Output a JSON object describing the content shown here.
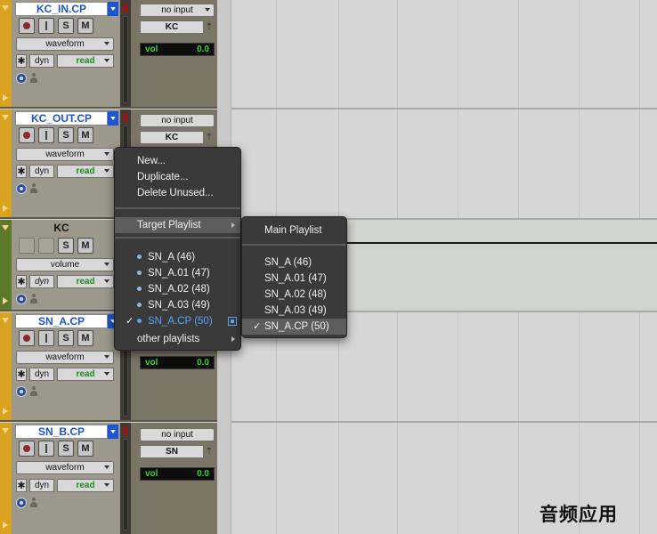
{
  "tracks": [
    {
      "name": "KC_IN.CP",
      "buttons": {
        "solo": "S",
        "mute": "M"
      },
      "view": "waveform",
      "dyn": "dyn",
      "automation": "read",
      "input": "no input",
      "output": "KC",
      "vol_label": "vol",
      "vol_value": "0.0"
    },
    {
      "name": "KC_OUT.CP",
      "buttons": {
        "solo": "S",
        "mute": "M"
      },
      "view": "waveform",
      "dyn": "dyn",
      "automation": "read",
      "input": "no input",
      "output": "KC"
    },
    {
      "name": "KC",
      "buttons": {
        "solo": "S",
        "mute": "M"
      },
      "view": "volume",
      "dyn": "dyn",
      "automation": "read"
    },
    {
      "name": "SN_A.CP",
      "buttons": {
        "solo": "S",
        "mute": "M"
      },
      "view": "waveform",
      "dyn": "dyn",
      "automation": "read",
      "vol_label": "vol",
      "vol_value": "0.0"
    },
    {
      "name": "SN_B.CP",
      "buttons": {
        "solo": "S",
        "mute": "M"
      },
      "view": "waveform",
      "dyn": "dyn",
      "automation": "read",
      "input": "no input",
      "output": "SN",
      "vol_label": "vol",
      "vol_value": "0.0"
    }
  ],
  "playlist_menu": {
    "actions": [
      "New...",
      "Duplicate...",
      "Delete Unused..."
    ],
    "target_playlist": "Target Playlist",
    "playlists": [
      "SN_A (46)",
      "SN_A.01 (47)",
      "SN_A.02 (48)",
      "SN_A.03 (49)",
      "SN_A.CP (50)"
    ],
    "current_playlist_check": "✓",
    "other_playlists": "other playlists"
  },
  "target_submenu": {
    "main": "Main Playlist",
    "playlists": [
      "SN_A (46)",
      "SN_A.01 (47)",
      "SN_A.02 (48)",
      "SN_A.03 (49)",
      "SN_A.CP (50)"
    ],
    "selected_check": "✓"
  },
  "watermark": "音频应用",
  "colors": {
    "track_audio": "#d9a31f",
    "track_aux": "#5c7a2c",
    "name_text": "#1b55d6",
    "menu_bg": "#3a3a3a",
    "current_playlist": "#5ba3f5",
    "volume_text": "#32d432"
  }
}
